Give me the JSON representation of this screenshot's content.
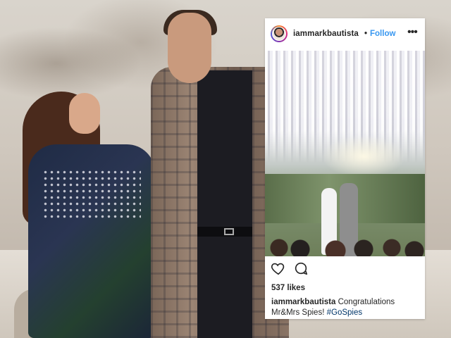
{
  "post": {
    "username": "iammarkbautista",
    "separator": "•",
    "follow_label": "Follow",
    "more_icon": "more-options-icon",
    "like_icon": "heart-icon",
    "comment_icon": "comment-icon",
    "likes_text": "537 likes",
    "caption_user": "iammarkbautista",
    "caption_text": "Congratulations Mr&Mrs Spies!",
    "caption_hashtag": "#GoSpies"
  },
  "colors": {
    "link_blue": "#3897f0",
    "text_dark": "#262626",
    "hashtag": "#003569"
  }
}
